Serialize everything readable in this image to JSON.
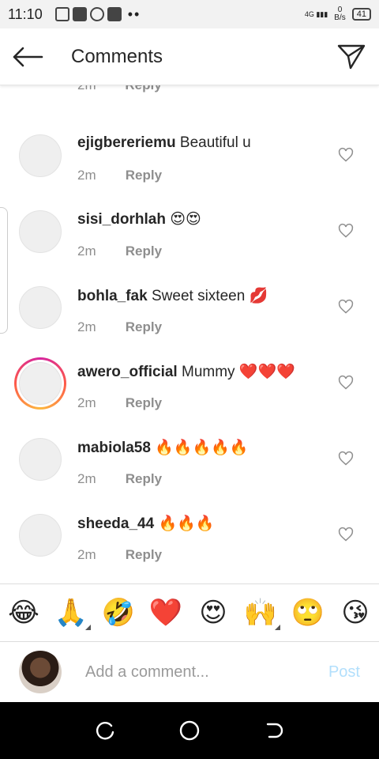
{
  "status": {
    "time": "11:10",
    "network": "4G",
    "speed_value": "0",
    "speed_unit": "B/s",
    "battery": "41"
  },
  "header": {
    "title": "Comments"
  },
  "partial_row": {
    "time": "2m",
    "reply": "Reply"
  },
  "comments": [
    {
      "user": "ejigbereriemu",
      "text": "Beautiful u",
      "time": "2m",
      "reply": "Reply",
      "story_ring": false
    },
    {
      "user": "sisi_dorhlah",
      "text": "😍😍",
      "time": "2m",
      "reply": "Reply",
      "story_ring": false
    },
    {
      "user": "bohla_fak",
      "text": "Sweet sixteen 💋",
      "time": "2m",
      "reply": "Reply",
      "story_ring": false
    },
    {
      "user": "awero_official",
      "text": "Mummy ❤️❤️❤️",
      "time": "2m",
      "reply": "Reply",
      "story_ring": true
    },
    {
      "user": "mabiola58",
      "text": "🔥🔥🔥🔥🔥",
      "time": "2m",
      "reply": "Reply",
      "story_ring": false
    },
    {
      "user": "sheeda_44",
      "text": "🔥🔥🔥",
      "time": "2m",
      "reply": "Reply",
      "story_ring": false
    }
  ],
  "emoji_bar": [
    "😂",
    "🙏",
    "🤣",
    "❤️",
    "😍",
    "🙌",
    "🙄",
    "😘"
  ],
  "input": {
    "placeholder": "Add a comment...",
    "post_label": "Post"
  },
  "colors": {
    "post_disabled": "#b2dffc",
    "meta_gray": "#8e8e8e",
    "story_ring_start": "#d6249f",
    "story_ring_end": "#fdb83f"
  }
}
